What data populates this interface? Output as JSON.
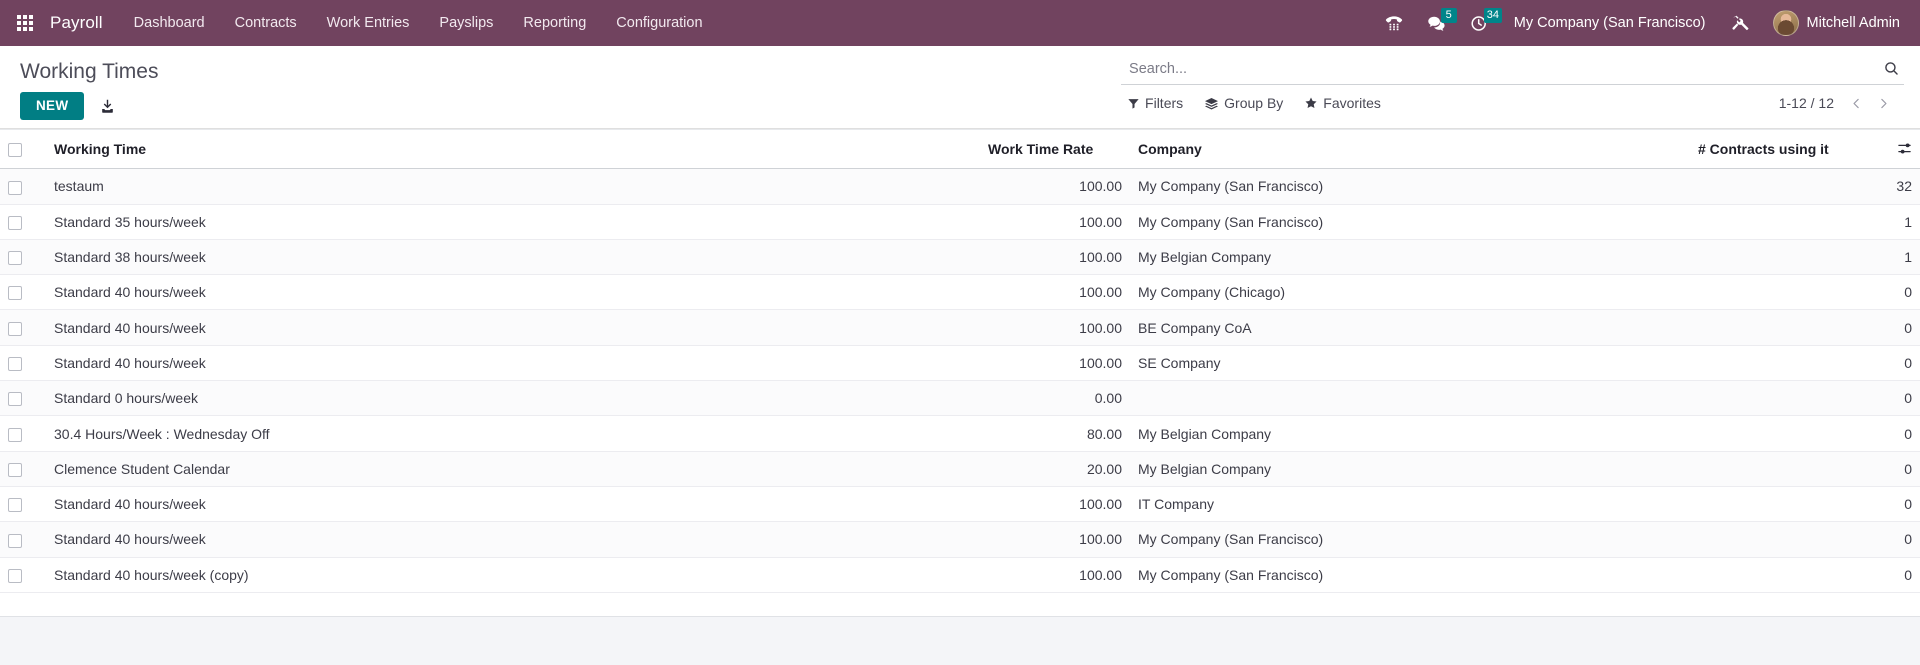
{
  "navbar": {
    "apps_icon": "apps-grid-icon",
    "brand": "Payroll",
    "menu_items": [
      {
        "label": "Dashboard"
      },
      {
        "label": "Contracts"
      },
      {
        "label": "Work Entries"
      },
      {
        "label": "Payslips"
      },
      {
        "label": "Reporting"
      },
      {
        "label": "Configuration"
      }
    ],
    "systray": {
      "voip_icon": "phone-icon",
      "messaging_icon": "messages-icon",
      "messaging_count": "5",
      "activities_icon": "clock-icon",
      "activities_count": "34",
      "company": "My Company (San Francisco)",
      "debug_icon": "tools-icon",
      "user_name": "Mitchell Admin",
      "avatar": "user-avatar"
    },
    "accent_color": "#71435f",
    "badge_color": "#00858a"
  },
  "control_panel": {
    "title": "Working Times",
    "new_label": "NEW",
    "export_icon": "download-icon",
    "primary_color": "#017e84"
  },
  "search": {
    "placeholder": "Search...",
    "value": "",
    "search_icon": "magnifier-icon",
    "dropdowns": [
      {
        "label": "Filters",
        "icon": "filter-icon"
      },
      {
        "label": "Group By",
        "icon": "layers-icon"
      },
      {
        "label": "Favorites",
        "icon": "star-icon"
      }
    ]
  },
  "pager": {
    "value": "1-12 / 12",
    "previous_icon": "chevron-left-icon",
    "next_icon": "chevron-right-icon"
  },
  "list": {
    "columns": [
      {
        "label": "Working Time",
        "align": "left"
      },
      {
        "label": "Work Time Rate",
        "align": "right"
      },
      {
        "label": "Company",
        "align": "left"
      },
      {
        "label": "# Contracts using it",
        "align": "right"
      }
    ],
    "optional_columns_icon": "column-settings-icon",
    "select_all_checkbox": "select-all-checkbox",
    "rows": [
      {
        "name": "testaum",
        "rate": "100.00",
        "company": "My Company (San Francisco)",
        "contracts": "32"
      },
      {
        "name": "Standard 35 hours/week",
        "rate": "100.00",
        "company": "My Company (San Francisco)",
        "contracts": "1"
      },
      {
        "name": "Standard 38 hours/week",
        "rate": "100.00",
        "company": "My Belgian Company",
        "contracts": "1"
      },
      {
        "name": "Standard 40 hours/week",
        "rate": "100.00",
        "company": "My Company (Chicago)",
        "contracts": "0"
      },
      {
        "name": "Standard 40 hours/week",
        "rate": "100.00",
        "company": "BE Company CoA",
        "contracts": "0"
      },
      {
        "name": "Standard 40 hours/week",
        "rate": "100.00",
        "company": "SE Company",
        "contracts": "0"
      },
      {
        "name": "Standard 0 hours/week",
        "rate": "0.00",
        "company": "",
        "contracts": "0"
      },
      {
        "name": "30.4 Hours/Week : Wednesday Off",
        "rate": "80.00",
        "company": "My Belgian Company",
        "contracts": "0"
      },
      {
        "name": "Clemence Student Calendar",
        "rate": "20.00",
        "company": "My Belgian Company",
        "contracts": "0"
      },
      {
        "name": "Standard 40 hours/week",
        "rate": "100.00",
        "company": "IT Company",
        "contracts": "0"
      },
      {
        "name": "Standard 40 hours/week",
        "rate": "100.00",
        "company": "My Company (San Francisco)",
        "contracts": "0"
      },
      {
        "name": "Standard 40 hours/week (copy)",
        "rate": "100.00",
        "company": "My Company (San Francisco)",
        "contracts": "0"
      }
    ]
  }
}
